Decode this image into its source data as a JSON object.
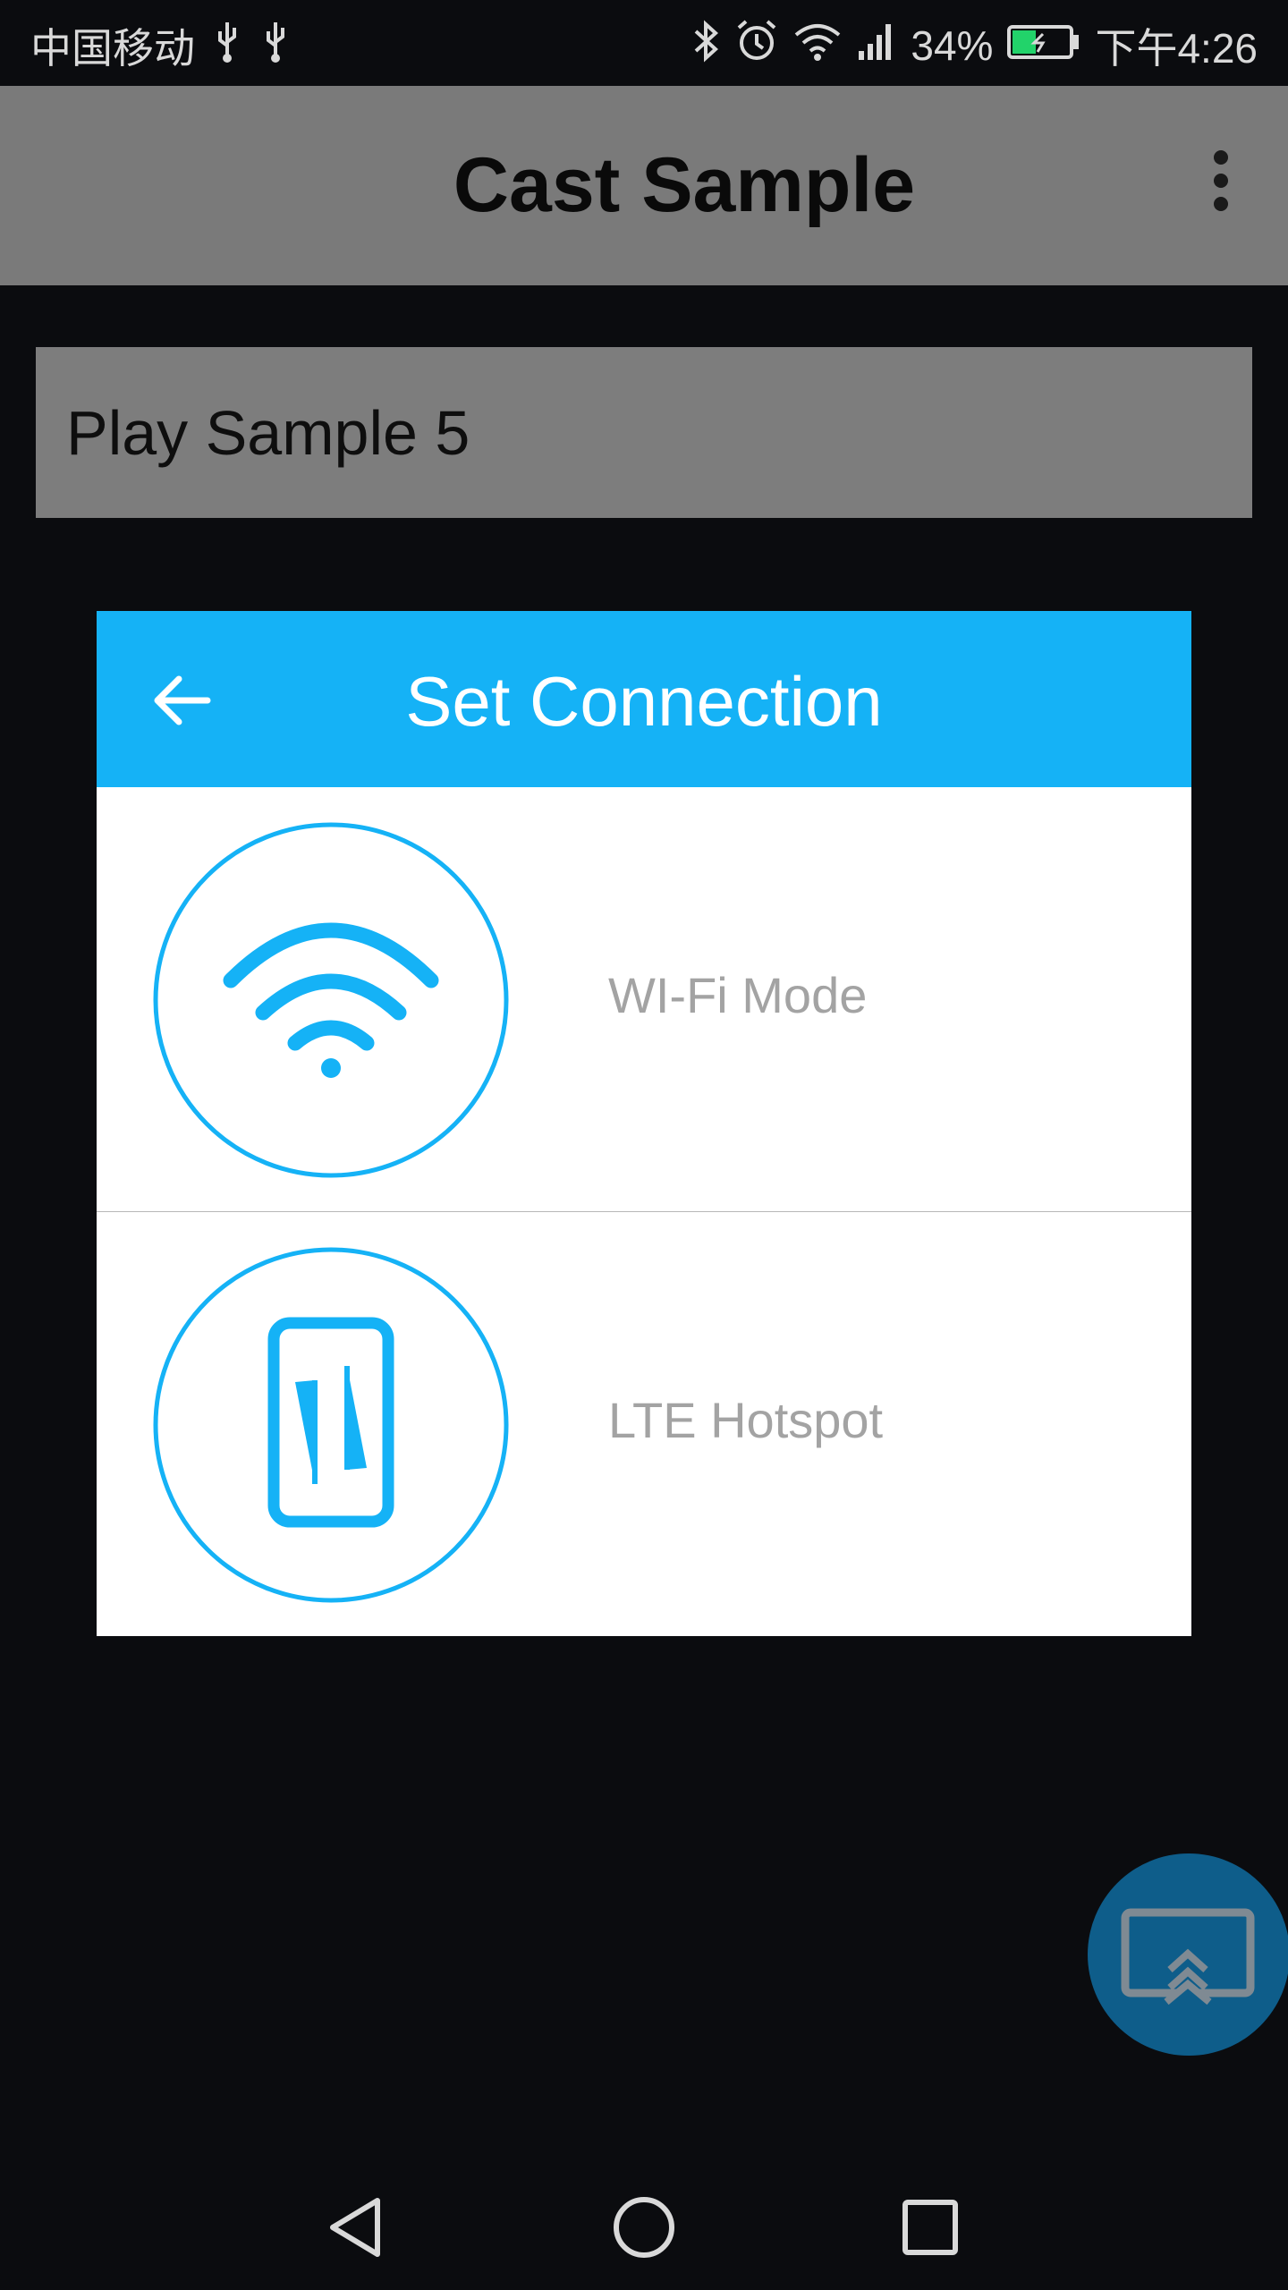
{
  "status_bar": {
    "carrier": "中国移动",
    "battery_percent": "34%",
    "time": "下午4:26",
    "icons": [
      "usb-icon",
      "usb-icon",
      "bluetooth-icon",
      "alarm-icon",
      "wifi-icon",
      "signal-icon",
      "battery-icon"
    ]
  },
  "app_bar": {
    "title": "Cast Sample",
    "menu_icon": "more-vert-icon"
  },
  "play_button": {
    "label": "Play Sample 5"
  },
  "dialog": {
    "title": "Set Connection",
    "back_icon": "arrow-left-icon",
    "options": [
      {
        "label": "WI-Fi Mode",
        "icon": "wifi-icon"
      },
      {
        "label": "LTE Hotspot",
        "icon": "phone-transfer-icon"
      }
    ]
  },
  "fab": {
    "icon": "cast-icon"
  },
  "colors": {
    "accent": "#15b2f6",
    "app_bar": "#7a7a7a",
    "background": "#0b0c0f",
    "fab": "#0e5d8a",
    "option_text": "#a3a3a3"
  }
}
